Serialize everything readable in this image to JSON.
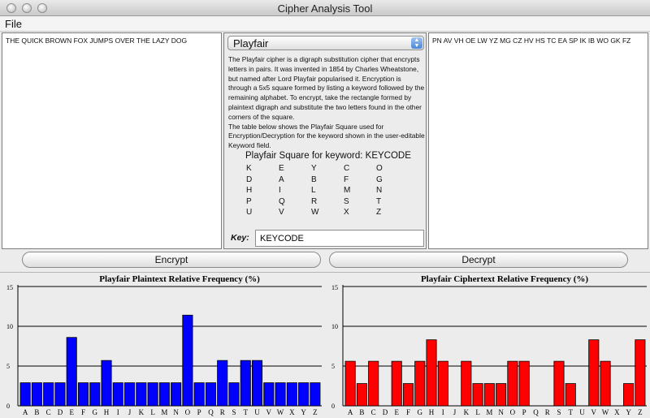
{
  "window": {
    "title": "Cipher Analysis Tool"
  },
  "menu": {
    "file": "File"
  },
  "plaintext": "THE QUICK BROWN FOX JUMPS OVER THE LAZY DOG",
  "ciphertext": "PN AV VH OE LW YZ MG CZ HV HS TC EA SP IK IB WO GK FZ",
  "cipher_select": {
    "selected": "Playfair"
  },
  "description": [
    "The Playfair cipher is a digraph substitution cipher that encrypts letters in pairs. It was invented in 1854 by Charles Wheatstone, but named after Lord Playfair popularised it. Encryption is through a 5x5 square formed by listing a keyword followed by the remaining alphabet. To encrypt, take the rectangle formed by plaintext digraph and substitute the two letters found in the other corners of the square.",
    "The table below shows the Playfair Square used for Encryption/Decryption for the keyword shown in the user-editable Keyword field."
  ],
  "square": {
    "title": "Playfair Square for keyword: KEYCODE",
    "rows": [
      [
        "K",
        "E",
        "Y",
        "C",
        "O"
      ],
      [
        "D",
        "A",
        "B",
        "F",
        "G"
      ],
      [
        "H",
        "I",
        "L",
        "M",
        "N"
      ],
      [
        "P",
        "Q",
        "R",
        "S",
        "T"
      ],
      [
        "U",
        "V",
        "W",
        "X",
        "Z"
      ]
    ]
  },
  "key": {
    "label": "Key:",
    "value": "KEYCODE"
  },
  "buttons": {
    "encrypt": "Encrypt",
    "decrypt": "Decrypt"
  },
  "chart_data": [
    {
      "type": "bar",
      "title": "Playfair Plaintext Relative Frequency (%)",
      "categories": [
        "A",
        "B",
        "C",
        "D",
        "E",
        "F",
        "G",
        "H",
        "I",
        "J",
        "K",
        "L",
        "M",
        "N",
        "O",
        "P",
        "Q",
        "R",
        "S",
        "T",
        "U",
        "V",
        "W",
        "X",
        "Y",
        "Z"
      ],
      "values": [
        2.9,
        2.9,
        2.9,
        2.9,
        8.6,
        2.9,
        2.9,
        5.7,
        2.9,
        2.9,
        2.9,
        2.9,
        2.9,
        2.9,
        11.4,
        2.9,
        2.9,
        5.7,
        2.9,
        5.7,
        5.7,
        2.9,
        2.9,
        2.9,
        2.9,
        2.9
      ],
      "ylim": [
        0,
        15
      ],
      "yticks": [
        0,
        5,
        10,
        15
      ],
      "color": "#0000ff",
      "grid": "horizontal"
    },
    {
      "type": "bar",
      "title": "Playfair Ciphertext Relative Frequency (%)",
      "categories": [
        "A",
        "B",
        "C",
        "D",
        "E",
        "F",
        "G",
        "H",
        "I",
        "J",
        "K",
        "L",
        "M",
        "N",
        "O",
        "P",
        "Q",
        "R",
        "S",
        "T",
        "U",
        "V",
        "W",
        "X",
        "Y",
        "Z"
      ],
      "values": [
        5.6,
        2.8,
        5.6,
        0,
        5.6,
        2.8,
        5.6,
        8.3,
        5.6,
        0,
        5.6,
        2.8,
        2.8,
        2.8,
        5.6,
        5.6,
        0,
        0,
        5.6,
        2.8,
        0,
        8.3,
        5.6,
        0,
        2.8,
        8.3
      ],
      "ylim": [
        0,
        15
      ],
      "yticks": [
        0,
        5,
        10,
        15
      ],
      "color": "#ff0000",
      "grid": "horizontal"
    }
  ]
}
